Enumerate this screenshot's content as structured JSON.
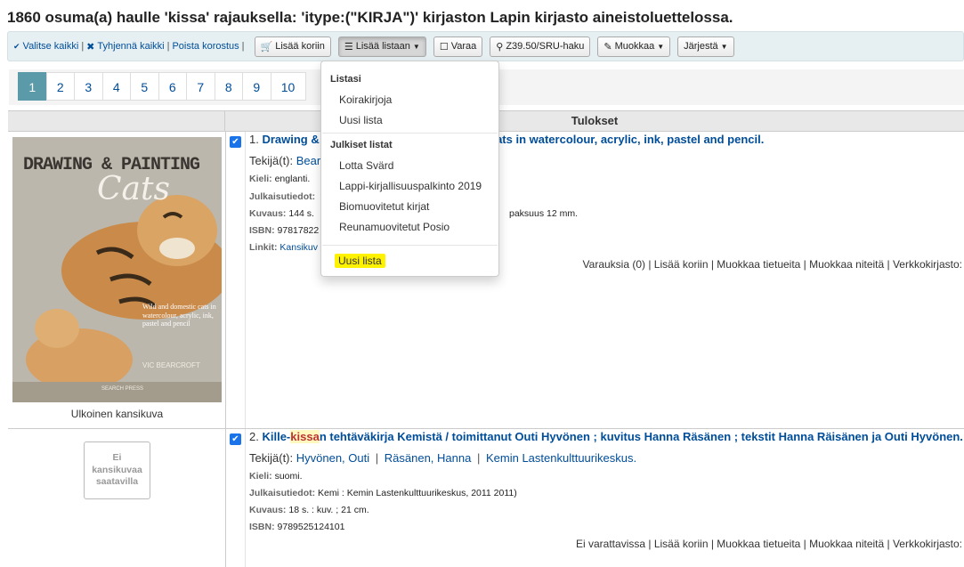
{
  "title": "1860 osuma(a) haulle 'kissa' rajauksella: 'itype:(\"KIRJA\")' kirjaston Lapin kirjasto aineistoluettelossa.",
  "toolbar": {
    "select_all": "Valitse kaikki",
    "clear_all": "Tyhjennä kaikki",
    "remove_highlight": "Poista korostus",
    "pipe": "|",
    "add_to_cart": "Lisää koriin",
    "add_to_list": "Lisää listaan",
    "place_hold": "Varaa",
    "z3950": "Z39.50/SRU-haku",
    "edit": "Muokkaa",
    "sort": "Järjestä"
  },
  "pager": {
    "pages": [
      "1",
      "2",
      "3",
      "4",
      "5",
      "6",
      "7",
      "8",
      "9",
      "10"
    ],
    "active": "1"
  },
  "results_header": "Tulokset",
  "dropdown": {
    "private_header": "Listasi",
    "private_items": [
      "Koirakirjoja",
      "Uusi lista"
    ],
    "public_header": "Julkiset listat",
    "public_items": [
      "Lotta Svärd",
      "Lappi-kirjallisuuspalkinto 2019",
      "Biomuovitetut kirjat",
      "Reunamuovitetut Posio"
    ],
    "new_list": "Uusi lista"
  },
  "results": [
    {
      "number": "1.",
      "title_start": "Drawing &",
      "title_end": "c cats in watercolour, acrylic, ink, pastel and pencil.",
      "authors_label": "Tekijä(t):",
      "authors": "Bear",
      "language_label": "Kieli:",
      "language": "englanti.",
      "publication_label": "Julkaisutiedot:",
      "publication": "",
      "description_label": "Kuvaus:",
      "description": "144 s.",
      "description_end": "paksuus 12 mm.",
      "isbn_label": "ISBN:",
      "isbn": "97817822",
      "links_label": "Linkit:",
      "links": "Kansikuv",
      "actions": "Varauksia (0) | Lisää koriin | Muokkaa tietueita | Muokkaa niteitä | Verkkokirjasto:",
      "cover_caption": "Ulkoinen kansikuva",
      "cover_title_1": "DRAWING & PAINTING",
      "cover_title_2": "Cats",
      "cover_subtitle": "Wild and domestic cats in watercolour, acrylic, ink, pastel and pencil",
      "cover_author": "VIC BEARCROFT",
      "cover_publisher": "SEARCH PRESS"
    },
    {
      "number": "2.",
      "title_pre": "Kille-",
      "title_hl": "kissa",
      "title_post": "n tehtäväkirja Kemistä / toimittanut Outi Hyvönen ; kuvitus Hanna Räsänen ; tekstit Hanna Räisänen ja Outi Hyvönen.",
      "authors_label": "Tekijä(t):",
      "authors": [
        "Hyvönen, Outi",
        "Räsänen, Hanna",
        "Kemin Lastenkulttuurikeskus."
      ],
      "language_label": "Kieli:",
      "language": "suomi.",
      "publication_label": "Julkaisutiedot:",
      "publication": "Kemi : Kemin Lastenkulttuurikeskus, 2011 2011)",
      "description_label": "Kuvaus:",
      "description": "18 s. : kuv. ; 21 cm.",
      "isbn_label": "ISBN:",
      "isbn": "9789525124101",
      "actions": "Ei varattavissa | Lisää koriin | Muokkaa tietueita | Muokkaa niteitä | Verkkokirjasto:",
      "no_cover": "Ei kansikuvaa saatavilla"
    }
  ]
}
